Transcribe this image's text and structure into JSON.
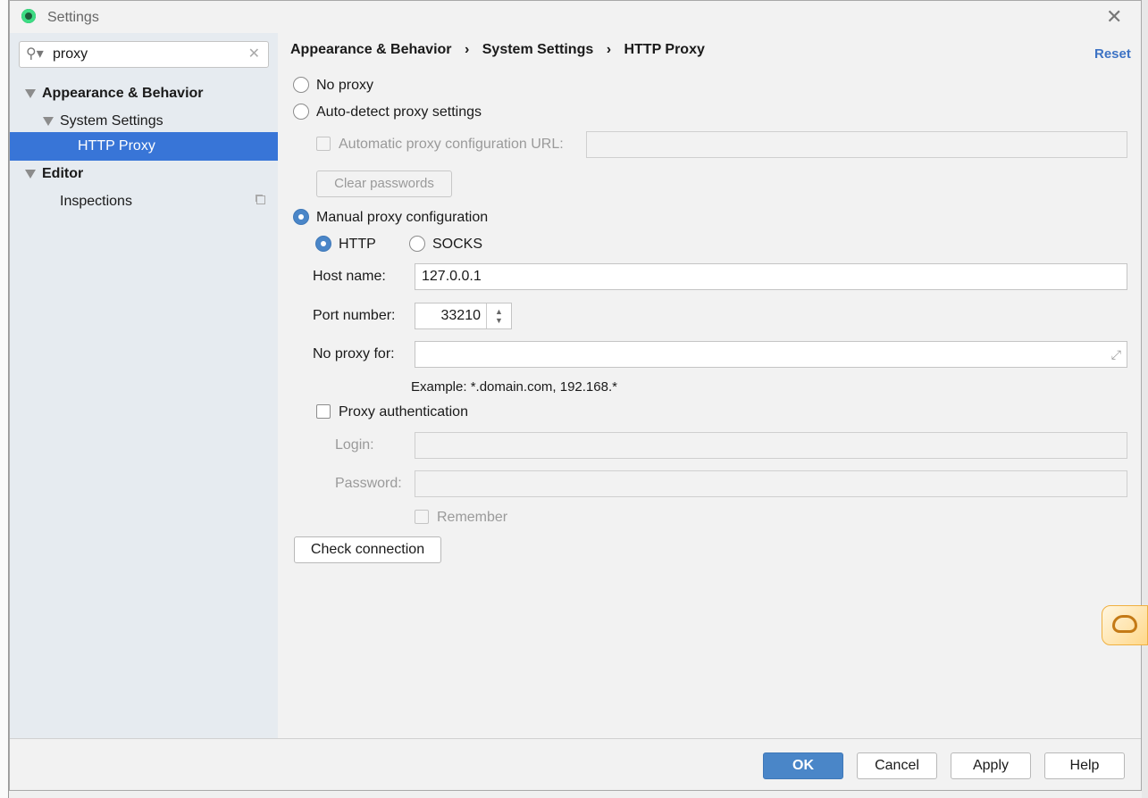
{
  "window": {
    "title": "Settings",
    "icon": "android-studio-icon"
  },
  "search": {
    "value": "proxy"
  },
  "tree": [
    {
      "label": "Appearance & Behavior",
      "bold": true
    },
    {
      "label": "System Settings"
    },
    {
      "label": "HTTP Proxy",
      "selected": true
    },
    {
      "label": "Editor",
      "bold": true
    },
    {
      "label": "Inspections"
    }
  ],
  "breadcrumb": [
    "Appearance & Behavior",
    "System Settings",
    "HTTP Proxy"
  ],
  "reset_label": "Reset",
  "form": {
    "no_proxy": "No proxy",
    "auto_detect": "Auto-detect proxy settings",
    "auto_url_label": "Automatic proxy configuration URL:",
    "auto_url_value": "",
    "clear_passwords": "Clear passwords",
    "manual": "Manual proxy configuration",
    "http": "HTTP",
    "socks": "SOCKS",
    "host_label": "Host name:",
    "host_value": "127.0.0.1",
    "port_label": "Port number:",
    "port_value": "33210",
    "no_proxy_for_label": "No proxy for:",
    "no_proxy_for_value": "",
    "example": "Example: *.domain.com, 192.168.*",
    "proxy_auth": "Proxy authentication",
    "login_label": "Login:",
    "password_label": "Password:",
    "remember": "Remember",
    "check_connection": "Check connection",
    "selected_mode": "manual",
    "selected_protocol": "HTTP"
  },
  "footer": {
    "ok": "OK",
    "cancel": "Cancel",
    "apply": "Apply",
    "help": "Help"
  },
  "colors": {
    "accent": "#4a86c8",
    "selection": "#3875d7",
    "link": "#3d73c4"
  }
}
